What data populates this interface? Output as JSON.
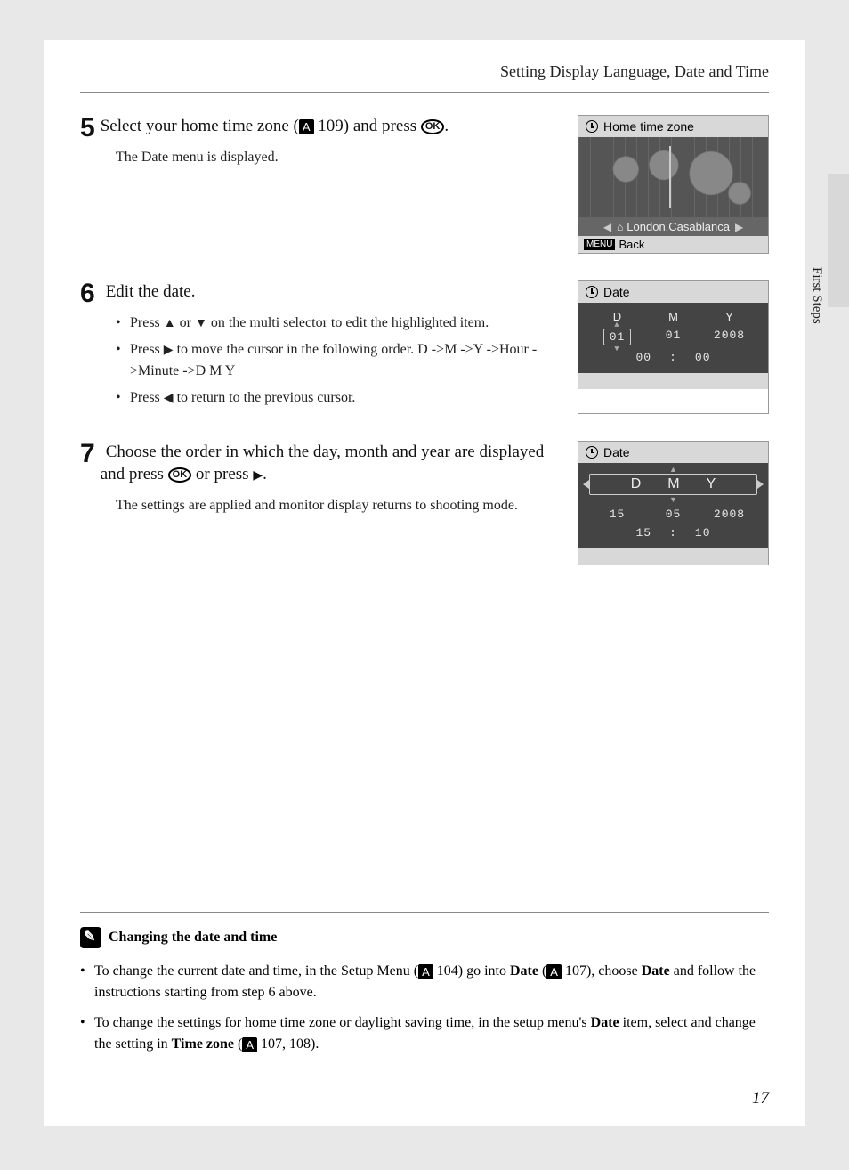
{
  "header": "Setting Display Language, Date and Time",
  "side_label": "First Steps",
  "page_number": "17",
  "step5": {
    "num": "5",
    "title_a": "Select your home time zone (",
    "title_ref": "A",
    "title_b": " 109) and press ",
    "title_c": ".",
    "body": "The Date menu is displayed.",
    "lcd": {
      "title": "Home time zone",
      "zone": "London,Casablanca",
      "back": "Back",
      "menu": "MENU"
    }
  },
  "step6": {
    "num": "6",
    "title": "Edit the date.",
    "b1a": "Press ",
    "b1b": " or ",
    "b1c": " on the multi selector to edit the highlighted item.",
    "b2a": "Press ",
    "b2b": " to move the cursor in the following order. D ->M ->Y ->Hour ->Minute ->D M Y",
    "b3a": "Press ",
    "b3b": " to return to the previous cursor.",
    "lcd": {
      "title": "Date",
      "d_label": "D",
      "m_label": "M",
      "y_label": "Y",
      "d": "01",
      "m": "01",
      "y": "2008",
      "hh": "00",
      "mm": "00"
    }
  },
  "step7": {
    "num": "7",
    "title_a": "Choose the order in which the day, month and year are displayed and press ",
    "title_b": " or press ",
    "title_c": ".",
    "body": "The settings are applied and monitor display returns to shooting mode.",
    "lcd": {
      "title": "Date",
      "d_label": "D",
      "m_label": "M",
      "y_label": "Y",
      "d": "15",
      "m": "05",
      "y": "2008",
      "hh": "15",
      "mm": "10"
    }
  },
  "note": {
    "title": "Changing the date and time",
    "li1a": "To change the current date and time, in the Setup Menu (",
    "li1b": " 104) go into ",
    "li1_date": "Date",
    "li1c": " (",
    "li1d": " 107), choose ",
    "li1_date2": "Date",
    "li1e": " and follow the instructions starting from step 6 above.",
    "li2a": "To change the settings for home time zone or daylight saving time, in the setup menu's ",
    "li2_date": "Date",
    "li2b": " item, select and change the setting in ",
    "li2_tz": "Time zone",
    "li2c": " (",
    "li2d": " 107, 108)."
  },
  "glyph": {
    "up": "▲",
    "down": "▼",
    "left": "◀",
    "right": "▶",
    "ok": "OK",
    "ref": "A"
  }
}
